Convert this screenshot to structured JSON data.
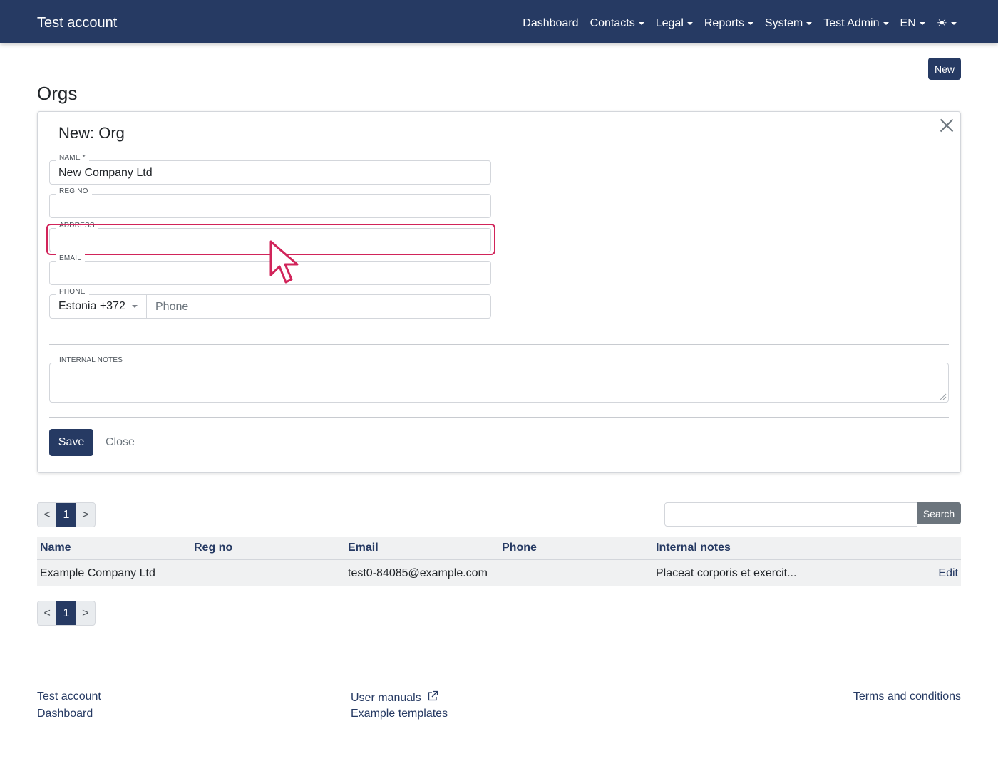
{
  "navbar": {
    "brand": "Test account",
    "items": [
      {
        "label": "Dashboard",
        "dropdown": false
      },
      {
        "label": "Contacts",
        "dropdown": true
      },
      {
        "label": "Legal",
        "dropdown": true
      },
      {
        "label": "Reports",
        "dropdown": true
      },
      {
        "label": "System",
        "dropdown": true
      },
      {
        "label": "Test Admin",
        "dropdown": true
      },
      {
        "label": "EN",
        "dropdown": true
      }
    ],
    "theme_icon": "sun-icon"
  },
  "page": {
    "new_button": "New",
    "title": "Orgs"
  },
  "form": {
    "title": "New: Org",
    "fields": {
      "name": {
        "label": "NAME *",
        "value": "New Company Ltd"
      },
      "reg_no": {
        "label": "REG NO",
        "value": ""
      },
      "address": {
        "label": "ADDRESS",
        "value": ""
      },
      "email": {
        "label": "EMAIL",
        "value": ""
      },
      "phone": {
        "label": "PHONE",
        "country": "Estonia +372",
        "placeholder": "Phone"
      },
      "internal_notes": {
        "label": "INTERNAL NOTES",
        "value": ""
      }
    },
    "save_label": "Save",
    "close_label": "Close"
  },
  "pagination": {
    "prev": "<",
    "current": "1",
    "next": ">"
  },
  "search": {
    "button": "Search",
    "value": ""
  },
  "table": {
    "headers": [
      "Name",
      "Reg no",
      "Email",
      "Phone",
      "Internal notes"
    ],
    "rows": [
      {
        "name": "Example Company Ltd",
        "reg_no": "",
        "email": "test0-84085@example.com",
        "phone": "",
        "notes": "Placeat corporis et exercit...",
        "action": "Edit"
      }
    ]
  },
  "footer": {
    "col1": [
      "Test account",
      "Dashboard"
    ],
    "col2": [
      "User manuals",
      "Example templates"
    ],
    "col3": [
      "Terms and conditions"
    ]
  },
  "colors": {
    "primary": "#263a63",
    "highlight": "#d1245a",
    "secondary": "#6c757d"
  }
}
